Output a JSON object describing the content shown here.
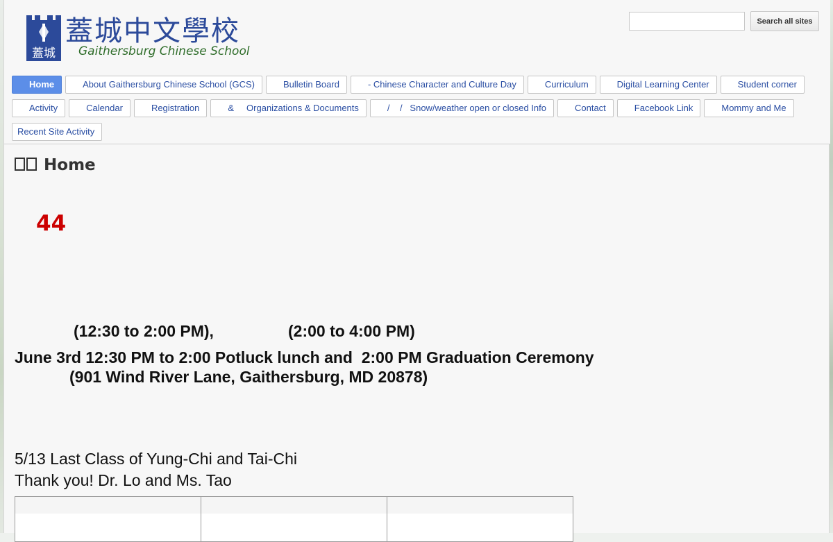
{
  "logo": {
    "chinese": "蓋城中文學校",
    "emblem_char": "蓋城",
    "english": "Gaithersburg Chinese School"
  },
  "search": {
    "input_value": "",
    "button_label": "Search all sites"
  },
  "nav": {
    "row1": [
      {
        "label": "Home",
        "active": true
      },
      {
        "label": "About Gaithersburg Chinese School (GCS)"
      },
      {
        "label": "Bulletin Board"
      },
      {
        "label": "- Chinese Character and Culture Day"
      },
      {
        "label": "Curriculum"
      },
      {
        "label": "Digital Learning Center"
      },
      {
        "label": "Student corner"
      }
    ],
    "row2": [
      {
        "label": "Activity"
      },
      {
        "label": "Calendar"
      },
      {
        "label": "Registration"
      },
      {
        "label": "&     Organizations & Documents"
      },
      {
        "label": "/    /   Snow/weather open or closed Info"
      },
      {
        "label": "Contact"
      },
      {
        "label": "Facebook Link"
      },
      {
        "label": "Mommy and Me"
      }
    ],
    "row3": [
      {
        "label": "Recent Site Activity"
      }
    ]
  },
  "content": {
    "page_title": "Home",
    "count": "44",
    "time_first": "(12:30 to 2:00 PM),",
    "time_second": "(2:00 to 4:00 PM)",
    "graduation": "June 3rd 12:30 PM to 2:00 Potluck lunch and  2:00 PM Graduation Ceremony",
    "address": "(901 Wind River Lane, Gaithersburg, MD 20878)",
    "last_class": "5/13 Last Class of Yung-Chi and Tai-Chi",
    "thanks": "Thank you! Dr. Lo and Ms. Tao"
  },
  "colors": {
    "accent_blue": "#5c8ee8",
    "link_blue": "#2a4ea3",
    "count_red": "#cc0000",
    "logo_blue": "#2c4a9a",
    "logo_green": "#2f6d2a"
  }
}
